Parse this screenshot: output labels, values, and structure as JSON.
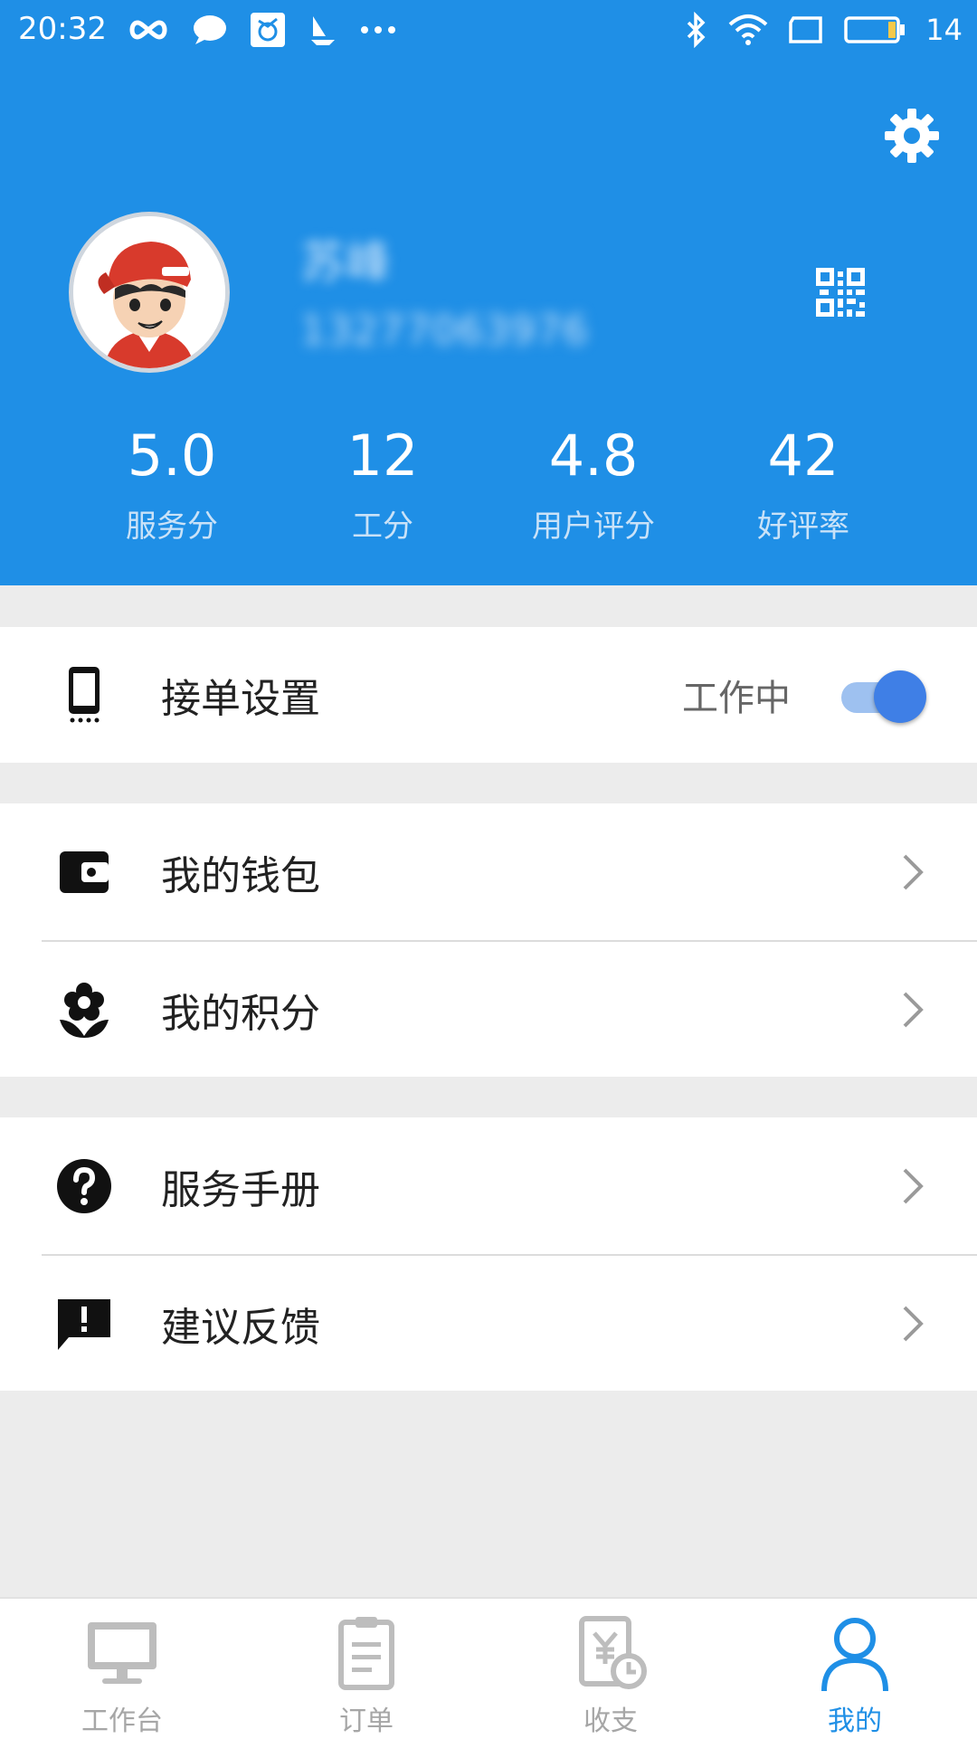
{
  "status_bar": {
    "time": "20:32",
    "battery_level": "14",
    "icons_left": [
      "infinity-icon",
      "chat-bubble-icon",
      "app-icon",
      "sailboat-icon",
      "more-dots-icon"
    ],
    "icons_right": [
      "bluetooth-icon",
      "wifi-icon",
      "screen-rotate-icon",
      "battery-icon"
    ]
  },
  "profile": {
    "name": "苏峰",
    "phone": "13277063976"
  },
  "stats": [
    {
      "value": "5.0",
      "label": "服务分"
    },
    {
      "value": "12",
      "label": "工分"
    },
    {
      "value": "4.8",
      "label": "用户评分"
    },
    {
      "value": "42",
      "label": "好评率"
    }
  ],
  "order_settings": {
    "label": "接单设置",
    "status": "工作中",
    "toggle_on": true
  },
  "menu_group_1": [
    {
      "label": "我的钱包",
      "icon": "wallet-icon"
    },
    {
      "label": "我的积分",
      "icon": "flower-icon"
    }
  ],
  "menu_group_2": [
    {
      "label": "服务手册",
      "icon": "help-circle-icon"
    },
    {
      "label": "建议反馈",
      "icon": "feedback-icon"
    }
  ],
  "bottom_nav": [
    {
      "label": "工作台",
      "icon": "monitor-icon",
      "active": false
    },
    {
      "label": "订单",
      "icon": "clipboard-icon",
      "active": false
    },
    {
      "label": "收支",
      "icon": "income-expense-icon",
      "active": false
    },
    {
      "label": "我的",
      "icon": "person-icon",
      "active": true
    }
  ],
  "colors": {
    "header_blue": "#1f8fe6",
    "toggle_blue": "#3f7fe6",
    "background": "#ececec"
  }
}
